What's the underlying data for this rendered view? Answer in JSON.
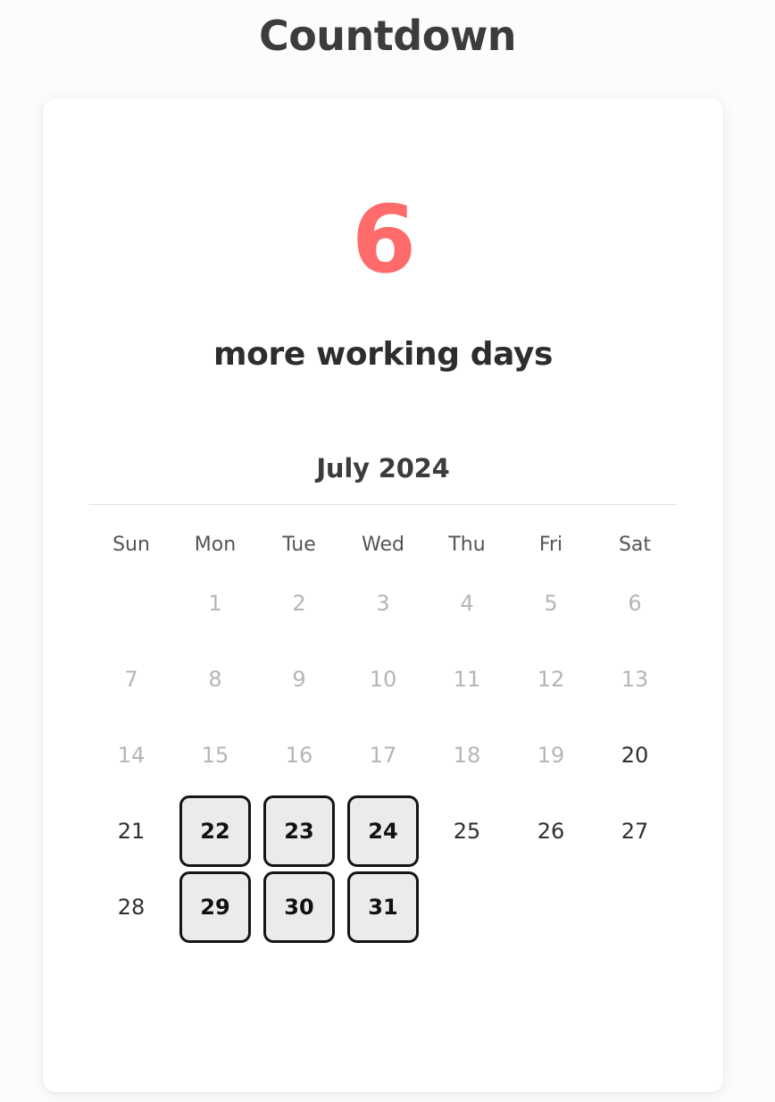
{
  "header": {
    "title": "Countdown"
  },
  "countdown": {
    "number": "6",
    "label": "more working days",
    "accent_color": "#ff6b6b"
  },
  "calendar": {
    "month_label": "July 2024",
    "weekdays": [
      "Sun",
      "Mon",
      "Tue",
      "Wed",
      "Thu",
      "Fri",
      "Sat"
    ],
    "weeks": [
      [
        {
          "label": "",
          "state": "empty"
        },
        {
          "label": "1",
          "state": "past"
        },
        {
          "label": "2",
          "state": "past"
        },
        {
          "label": "3",
          "state": "past"
        },
        {
          "label": "4",
          "state": "past"
        },
        {
          "label": "5",
          "state": "past"
        },
        {
          "label": "6",
          "state": "past"
        }
      ],
      [
        {
          "label": "7",
          "state": "past"
        },
        {
          "label": "8",
          "state": "past"
        },
        {
          "label": "9",
          "state": "past"
        },
        {
          "label": "10",
          "state": "past"
        },
        {
          "label": "11",
          "state": "past"
        },
        {
          "label": "12",
          "state": "past"
        },
        {
          "label": "13",
          "state": "past"
        }
      ],
      [
        {
          "label": "14",
          "state": "past"
        },
        {
          "label": "15",
          "state": "past"
        },
        {
          "label": "16",
          "state": "past"
        },
        {
          "label": "17",
          "state": "past"
        },
        {
          "label": "18",
          "state": "past"
        },
        {
          "label": "19",
          "state": "past"
        },
        {
          "label": "20",
          "state": "normal"
        }
      ],
      [
        {
          "label": "21",
          "state": "normal"
        },
        {
          "label": "22",
          "state": "workday"
        },
        {
          "label": "23",
          "state": "workday"
        },
        {
          "label": "24",
          "state": "workday"
        },
        {
          "label": "25",
          "state": "normal"
        },
        {
          "label": "26",
          "state": "normal"
        },
        {
          "label": "27",
          "state": "normal"
        }
      ],
      [
        {
          "label": "28",
          "state": "normal"
        },
        {
          "label": "29",
          "state": "workday"
        },
        {
          "label": "30",
          "state": "workday"
        },
        {
          "label": "31",
          "state": "workday"
        },
        {
          "label": "",
          "state": "empty"
        },
        {
          "label": "",
          "state": "empty"
        },
        {
          "label": "",
          "state": "empty"
        }
      ]
    ]
  }
}
